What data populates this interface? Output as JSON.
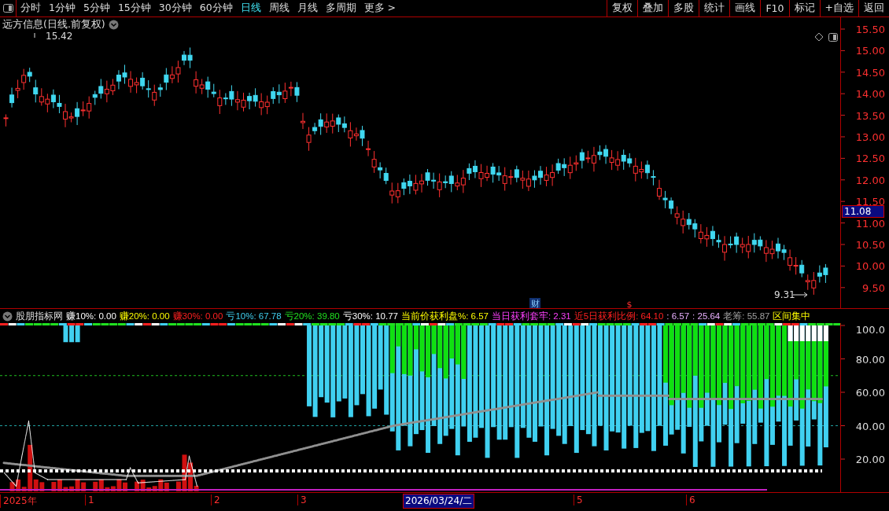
{
  "toolbar": {
    "periods": [
      {
        "label": "分时",
        "selected": false
      },
      {
        "label": "1分钟",
        "selected": false
      },
      {
        "label": "5分钟",
        "selected": false
      },
      {
        "label": "15分钟",
        "selected": false
      },
      {
        "label": "30分钟",
        "selected": false
      },
      {
        "label": "60分钟",
        "selected": false
      },
      {
        "label": "日线",
        "selected": true
      },
      {
        "label": "周线",
        "selected": false
      },
      {
        "label": "月线",
        "selected": false
      },
      {
        "label": "多周期",
        "selected": false
      },
      {
        "label": "更多 >",
        "selected": false
      }
    ],
    "buttons": [
      "复权",
      "叠加",
      "多股",
      "统计",
      "画线",
      "F10",
      "标记",
      "+自选",
      "返回"
    ]
  },
  "main_chart": {
    "title": "远方信息(日线.前复权)",
    "high_label": "15.42",
    "low_label": "9.31",
    "price_tag": "11.08",
    "y_ticks": [
      "15.50",
      "15.00",
      "14.50",
      "14.00",
      "13.50",
      "13.00",
      "12.50",
      "12.00",
      "11.50",
      "11.00",
      "10.50",
      "10.00",
      "9.50"
    ],
    "markers": [
      {
        "text": "财",
        "kind": "box"
      },
      {
        "text": "$",
        "kind": "plain"
      }
    ]
  },
  "indicator": {
    "name": "股朋指标网",
    "readings": [
      {
        "text": "赚10%: 0.00",
        "kind": "plain"
      },
      {
        "text": "赚20%: 0.00",
        "kind": "accent"
      },
      {
        "text": "赚30%: 0.00",
        "kind": "alert"
      },
      {
        "text": "亏10%: 67.78",
        "kind": "cool"
      },
      {
        "text": "亏20%: 39.80",
        "kind": "positive"
      },
      {
        "text": "亏30%: 10.77",
        "kind": "plain"
      },
      {
        "text": "当前价获利盘%: 6.57",
        "kind": "accent"
      },
      {
        "text": "当日获利套牢: 2.31",
        "kind": "vivid"
      },
      {
        "text": "近5日获利比例: 64.10",
        "kind": "alert"
      },
      {
        "text": ": 6.57",
        "kind": "soft"
      },
      {
        "text": ": 25.64",
        "kind": "soft"
      },
      {
        "text": "老筹: 55.87",
        "kind": "muted"
      },
      {
        "text": "区间集中",
        "kind": "accent"
      }
    ],
    "y_ticks": [
      "100.0",
      "80.00",
      "60.00",
      "40.00",
      "20.00"
    ]
  },
  "date_axis": {
    "labels": [
      {
        "text": "2025年",
        "kind": "plain"
      },
      {
        "text": "1",
        "kind": "plain"
      },
      {
        "text": "2",
        "kind": "plain"
      },
      {
        "text": "3",
        "kind": "plain"
      },
      {
        "text": "2026/03/24/二",
        "kind": "cursor"
      },
      {
        "text": "5",
        "kind": "plain"
      },
      {
        "text": "6",
        "kind": "plain"
      }
    ]
  }
}
